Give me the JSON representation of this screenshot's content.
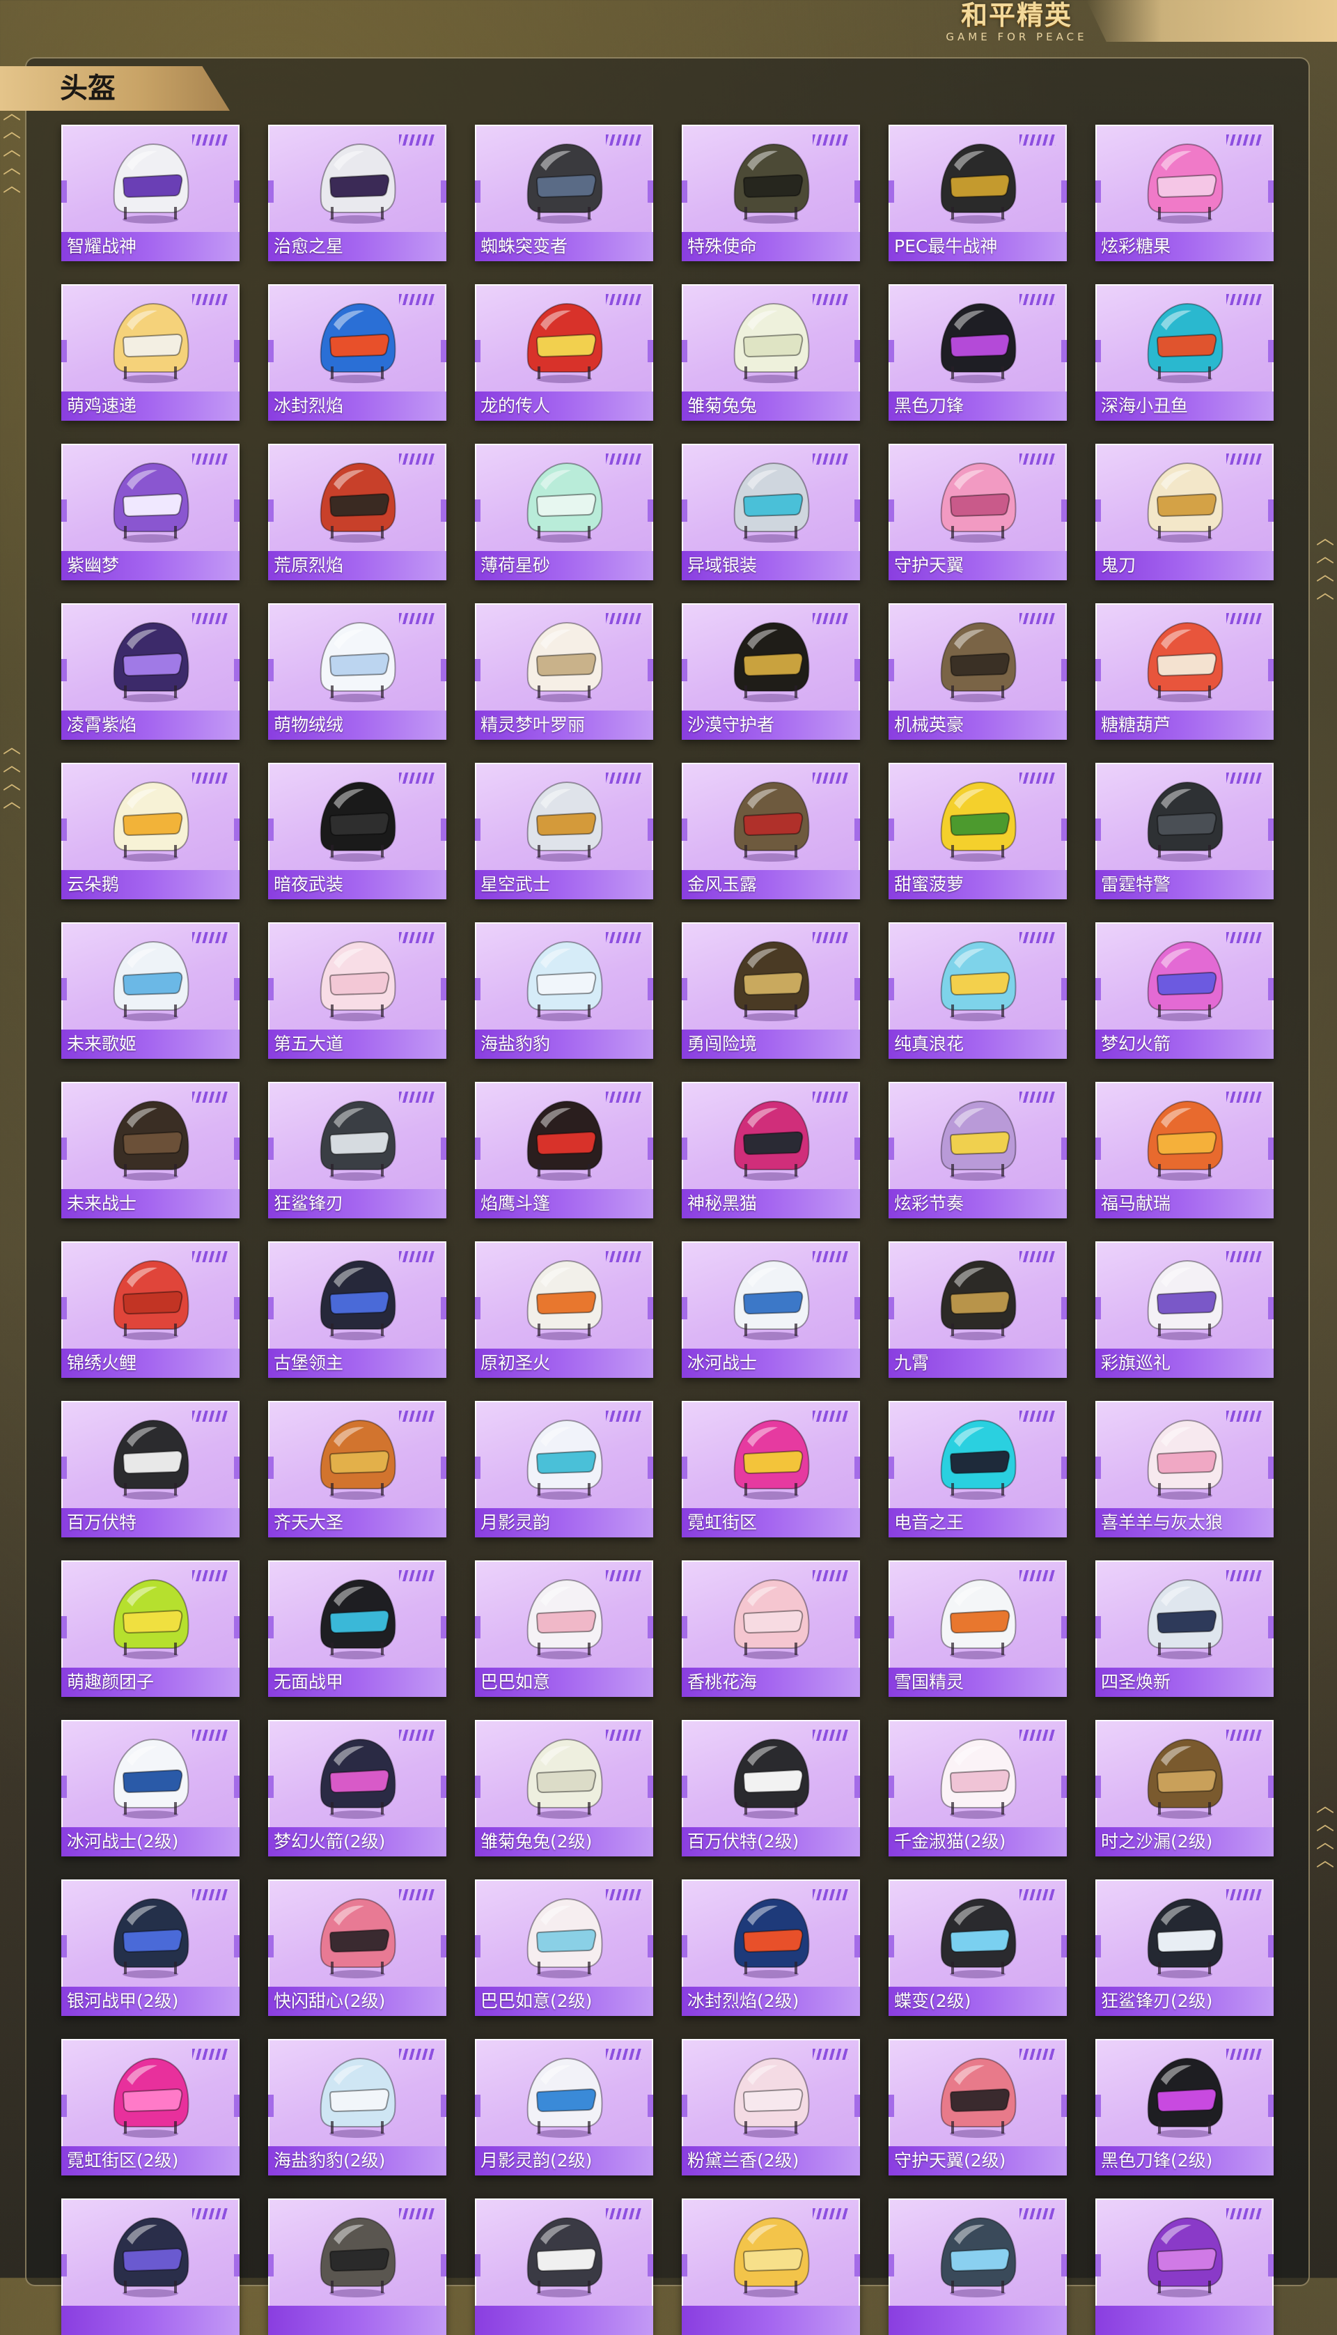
{
  "logo": {
    "main": "和平精英",
    "sub": "GAME FOR PEACE"
  },
  "section": {
    "title": "头盔"
  },
  "helmets": [
    {
      "name": "智耀战神",
      "icon": "helmet-icon",
      "color": "#f0f0f4",
      "visor": "#6a3fb5"
    },
    {
      "name": "治愈之星",
      "icon": "helmet-icon",
      "color": "#e9e9ee",
      "visor": "#3b2a56"
    },
    {
      "name": "蜘蛛突变者",
      "icon": "helmet-icon",
      "color": "#3a3a3e",
      "visor": "#5a6b86"
    },
    {
      "name": "特殊使命",
      "icon": "helmet-icon",
      "color": "#4c4a36",
      "visor": "#26261e"
    },
    {
      "name": "PEC最牛战神",
      "icon": "helmet-icon",
      "color": "#2a2a2a",
      "visor": "#c49a2e"
    },
    {
      "name": "炫彩糖果",
      "icon": "helmet-icon",
      "color": "#f07ac8",
      "visor": "#f5c6e6"
    },
    {
      "name": "萌鸡速递",
      "icon": "helmet-icon",
      "color": "#f5d27a",
      "visor": "#f3efe3"
    },
    {
      "name": "冰封烈焰",
      "icon": "helmet-icon",
      "color": "#2a6fd6",
      "visor": "#e8502a"
    },
    {
      "name": "龙的传人",
      "icon": "helmet-icon",
      "color": "#d8322a",
      "visor": "#f2d04e"
    },
    {
      "name": "雏菊兔兔",
      "icon": "helmet-icon",
      "color": "#eef1dc",
      "visor": "#dfe4c4"
    },
    {
      "name": "黑色刀锋",
      "icon": "helmet-icon",
      "color": "#1e1e24",
      "visor": "#b44ad8"
    },
    {
      "name": "深海小丑鱼",
      "icon": "helmet-icon",
      "color": "#2ab8cf",
      "visor": "#e0542e"
    },
    {
      "name": "紫幽梦",
      "icon": "helmet-icon",
      "color": "#8a56d0",
      "visor": "#f0e8ff"
    },
    {
      "name": "荒原烈焰",
      "icon": "helmet-icon",
      "color": "#c8402a",
      "visor": "#3a2a22"
    },
    {
      "name": "薄荷星砂",
      "icon": "helmet-icon",
      "color": "#b9ecd9",
      "visor": "#e7f7f0"
    },
    {
      "name": "异域银装",
      "icon": "helmet-icon",
      "color": "#cfd6de",
      "visor": "#4ac0d8"
    },
    {
      "name": "守护天翼",
      "icon": "helmet-icon",
      "color": "#f29ac2",
      "visor": "#c95a8a"
    },
    {
      "name": "鬼刀",
      "icon": "helmet-icon",
      "color": "#f3e7c9",
      "visor": "#d4a246"
    },
    {
      "name": "凌霄紫焰",
      "icon": "helmet-icon",
      "color": "#3c2a6a",
      "visor": "#a07ae6"
    },
    {
      "name": "萌物绒绒",
      "icon": "helmet-icon",
      "color": "#f4f7fb",
      "visor": "#bcd5f0"
    },
    {
      "name": "精灵梦叶罗丽",
      "icon": "helmet-icon",
      "color": "#f6efe6",
      "visor": "#c9b28a"
    },
    {
      "name": "沙漠守护者",
      "icon": "helmet-icon",
      "color": "#1f1d18",
      "visor": "#c9a23e"
    },
    {
      "name": "机械英豪",
      "icon": "helmet-icon",
      "color": "#7a6446",
      "visor": "#3a3025"
    },
    {
      "name": "糖糖葫芦",
      "icon": "helmet-icon",
      "color": "#e8553c",
      "visor": "#f4e2d0"
    },
    {
      "name": "云朵鹅",
      "icon": "helmet-icon",
      "color": "#f7f2d6",
      "visor": "#f2b339"
    },
    {
      "name": "暗夜武装",
      "icon": "helmet-icon",
      "color": "#1a1a1a",
      "visor": "#2e2e2e"
    },
    {
      "name": "星空武士",
      "icon": "helmet-icon",
      "color": "#dfe3ea",
      "visor": "#d49a3a"
    },
    {
      "name": "金风玉露",
      "icon": "helmet-icon",
      "color": "#6e5a3e",
      "visor": "#b0302a"
    },
    {
      "name": "甜蜜菠萝",
      "icon": "helmet-icon",
      "color": "#f4d02c",
      "visor": "#4c9a2e"
    },
    {
      "name": "雷霆特警",
      "icon": "helmet-icon",
      "color": "#2e3134",
      "visor": "#4a4f55"
    },
    {
      "name": "未来歌姬",
      "icon": "helmet-icon",
      "color": "#eef3f8",
      "visor": "#6bb8e6"
    },
    {
      "name": "第五大道",
      "icon": "helmet-icon",
      "color": "#f8dde6",
      "visor": "#f3c8d6"
    },
    {
      "name": "海盐豹豹",
      "icon": "helmet-icon",
      "color": "#d6ecf8",
      "visor": "#f1f6fb"
    },
    {
      "name": "勇闯险境",
      "icon": "helmet-icon",
      "color": "#4a3a24",
      "visor": "#c9a95e"
    },
    {
      "name": "纯真浪花",
      "icon": "helmet-icon",
      "color": "#7ed3ea",
      "visor": "#f3d04c"
    },
    {
      "name": "梦幻火箭",
      "icon": "helmet-icon",
      "color": "#e36ad4",
      "visor": "#6c5ae0"
    },
    {
      "name": "未来战士",
      "icon": "helmet-icon",
      "color": "#3a2e24",
      "visor": "#6b5038"
    },
    {
      "name": "狂鲨锋刃",
      "icon": "helmet-icon",
      "color": "#3a3e44",
      "visor": "#d6dbe0"
    },
    {
      "name": "焰鹰斗篷",
      "icon": "helmet-icon",
      "color": "#2a1e1e",
      "visor": "#d8322a"
    },
    {
      "name": "神秘黑猫",
      "icon": "helmet-icon",
      "color": "#d02e7a",
      "visor": "#2a2a34"
    },
    {
      "name": "炫彩节奏",
      "icon": "helmet-icon",
      "color": "#b99ad8",
      "visor": "#f0d04e"
    },
    {
      "name": "福马献瑞",
      "icon": "helmet-icon",
      "color": "#e86a2e",
      "visor": "#f5b03a"
    },
    {
      "name": "锦绣火鲤",
      "icon": "helmet-icon",
      "color": "#e0453a",
      "visor": "#c23424"
    },
    {
      "name": "古堡领主",
      "icon": "helmet-icon",
      "color": "#26283a",
      "visor": "#4a6ad8"
    },
    {
      "name": "原初圣火",
      "icon": "helmet-icon",
      "color": "#f2f0ea",
      "visor": "#e8772e"
    },
    {
      "name": "冰河战士",
      "icon": "helmet-icon",
      "color": "#f1f4f8",
      "visor": "#3c78c8"
    },
    {
      "name": "九霄",
      "icon": "helmet-icon",
      "color": "#2c2a26",
      "visor": "#b8944a"
    },
    {
      "name": "彩旗巡礼",
      "icon": "helmet-icon",
      "color": "#f4f1f6",
      "visor": "#7a58c8"
    },
    {
      "name": "百万伏特",
      "icon": "helmet-icon",
      "color": "#2b2b2e",
      "visor": "#e8e8e8"
    },
    {
      "name": "齐天大圣",
      "icon": "helmet-icon",
      "color": "#d2742e",
      "visor": "#e3b04a"
    },
    {
      "name": "月影灵韵",
      "icon": "helmet-icon",
      "color": "#f1f3fa",
      "visor": "#4ac0d8"
    },
    {
      "name": "霓虹街区",
      "icon": "helmet-icon",
      "color": "#e63aa0",
      "visor": "#f3c43a"
    },
    {
      "name": "电音之王",
      "icon": "helmet-icon",
      "color": "#2ad0e0",
      "visor": "#1e2a3a"
    },
    {
      "name": "喜羊羊与灰太狼",
      "icon": "helmet-icon",
      "color": "#f7e9ef",
      "visor": "#f0a8c4"
    },
    {
      "name": "萌趣颜团子",
      "icon": "helmet-icon",
      "color": "#b6e02e",
      "visor": "#f0e040"
    },
    {
      "name": "无面战甲",
      "icon": "helmet-icon",
      "color": "#1e1e22",
      "visor": "#3ab8d8"
    },
    {
      "name": "巴巴如意",
      "icon": "helmet-icon",
      "color": "#f5f2f6",
      "visor": "#f0b8c8"
    },
    {
      "name": "香桃花海",
      "icon": "helmet-icon",
      "color": "#f5c6d0",
      "visor": "#f7dbe2"
    },
    {
      "name": "雪国精灵",
      "icon": "helmet-icon",
      "color": "#f4f6f8",
      "visor": "#e8772e"
    },
    {
      "name": "四圣焕新",
      "icon": "helmet-icon",
      "color": "#dfe6ee",
      "visor": "#2e3a5a"
    },
    {
      "name": "冰河战士(2级)",
      "icon": "helmet-icon",
      "color": "#f4f6fa",
      "visor": "#2a5aa8"
    },
    {
      "name": "梦幻火箭(2级)",
      "icon": "helmet-icon",
      "color": "#2a2a44",
      "visor": "#d85ac8"
    },
    {
      "name": "雏菊兔兔(2级)",
      "icon": "helmet-icon",
      "color": "#eeefdf",
      "visor": "#dcdcc8"
    },
    {
      "name": "百万伏特(2级)",
      "icon": "helmet-icon",
      "color": "#2a2a2e",
      "visor": "#f2f2f2"
    },
    {
      "name": "千金淑猫(2级)",
      "icon": "helmet-icon",
      "color": "#fbf3f7",
      "visor": "#f0c4d6"
    },
    {
      "name": "时之沙漏(2级)",
      "icon": "helmet-icon",
      "color": "#7a5a2e",
      "visor": "#c9a05a"
    },
    {
      "name": "银河战甲(2级)",
      "icon": "helmet-icon",
      "color": "#24304a",
      "visor": "#4a6ad8"
    },
    {
      "name": "快闪甜心(2级)",
      "icon": "helmet-icon",
      "color": "#e87a94",
      "visor": "#3a2a30"
    },
    {
      "name": "巴巴如意(2级)",
      "icon": "helmet-icon",
      "color": "#f6eef0",
      "visor": "#8ad0e6"
    },
    {
      "name": "冰封烈焰(2级)",
      "icon": "helmet-icon",
      "color": "#1e3a7a",
      "visor": "#e8502a"
    },
    {
      "name": "蝶变(2级)",
      "icon": "helmet-icon",
      "color": "#2a2a2e",
      "visor": "#7ad0f0"
    },
    {
      "name": "狂鲨锋刃(2级)",
      "icon": "helmet-icon",
      "color": "#242832",
      "visor": "#e8eef4"
    },
    {
      "name": "霓虹街区(2级)",
      "icon": "helmet-icon",
      "color": "#e8309c",
      "visor": "#ff7ac8"
    },
    {
      "name": "海盐豹豹(2级)",
      "icon": "helmet-icon",
      "color": "#cfe6f4",
      "visor": "#f2f6fa"
    },
    {
      "name": "月影灵韵(2级)",
      "icon": "helmet-icon",
      "color": "#f2f2f8",
      "visor": "#3a8ad8"
    },
    {
      "name": "粉黛兰香(2级)",
      "icon": "helmet-icon",
      "color": "#f4dbe4",
      "visor": "#f7e8ee"
    },
    {
      "name": "守护天翼(2级)",
      "icon": "helmet-icon",
      "color": "#e87a8a",
      "visor": "#3a2a2e"
    },
    {
      "name": "黑色刀锋(2级)",
      "icon": "helmet-icon",
      "color": "#1e1e22",
      "visor": "#c84ae0"
    },
    {
      "name": "",
      "icon": "helmet-icon",
      "color": "#2a2e4a",
      "visor": "#6a5ad0"
    },
    {
      "name": "",
      "icon": "helmet-icon",
      "color": "#5a5650",
      "visor": "#2a2a2a"
    },
    {
      "name": "",
      "icon": "helmet-icon",
      "color": "#3a3a44",
      "visor": "#f0f0f0"
    },
    {
      "name": "",
      "icon": "helmet-icon",
      "color": "#f3c44a",
      "visor": "#f7e08a"
    },
    {
      "name": "",
      "icon": "helmet-icon",
      "color": "#3a4a5a",
      "visor": "#8ad0f0"
    },
    {
      "name": "",
      "icon": "helmet-icon",
      "color": "#8a3ac8",
      "visor": "#d07ae6"
    }
  ]
}
